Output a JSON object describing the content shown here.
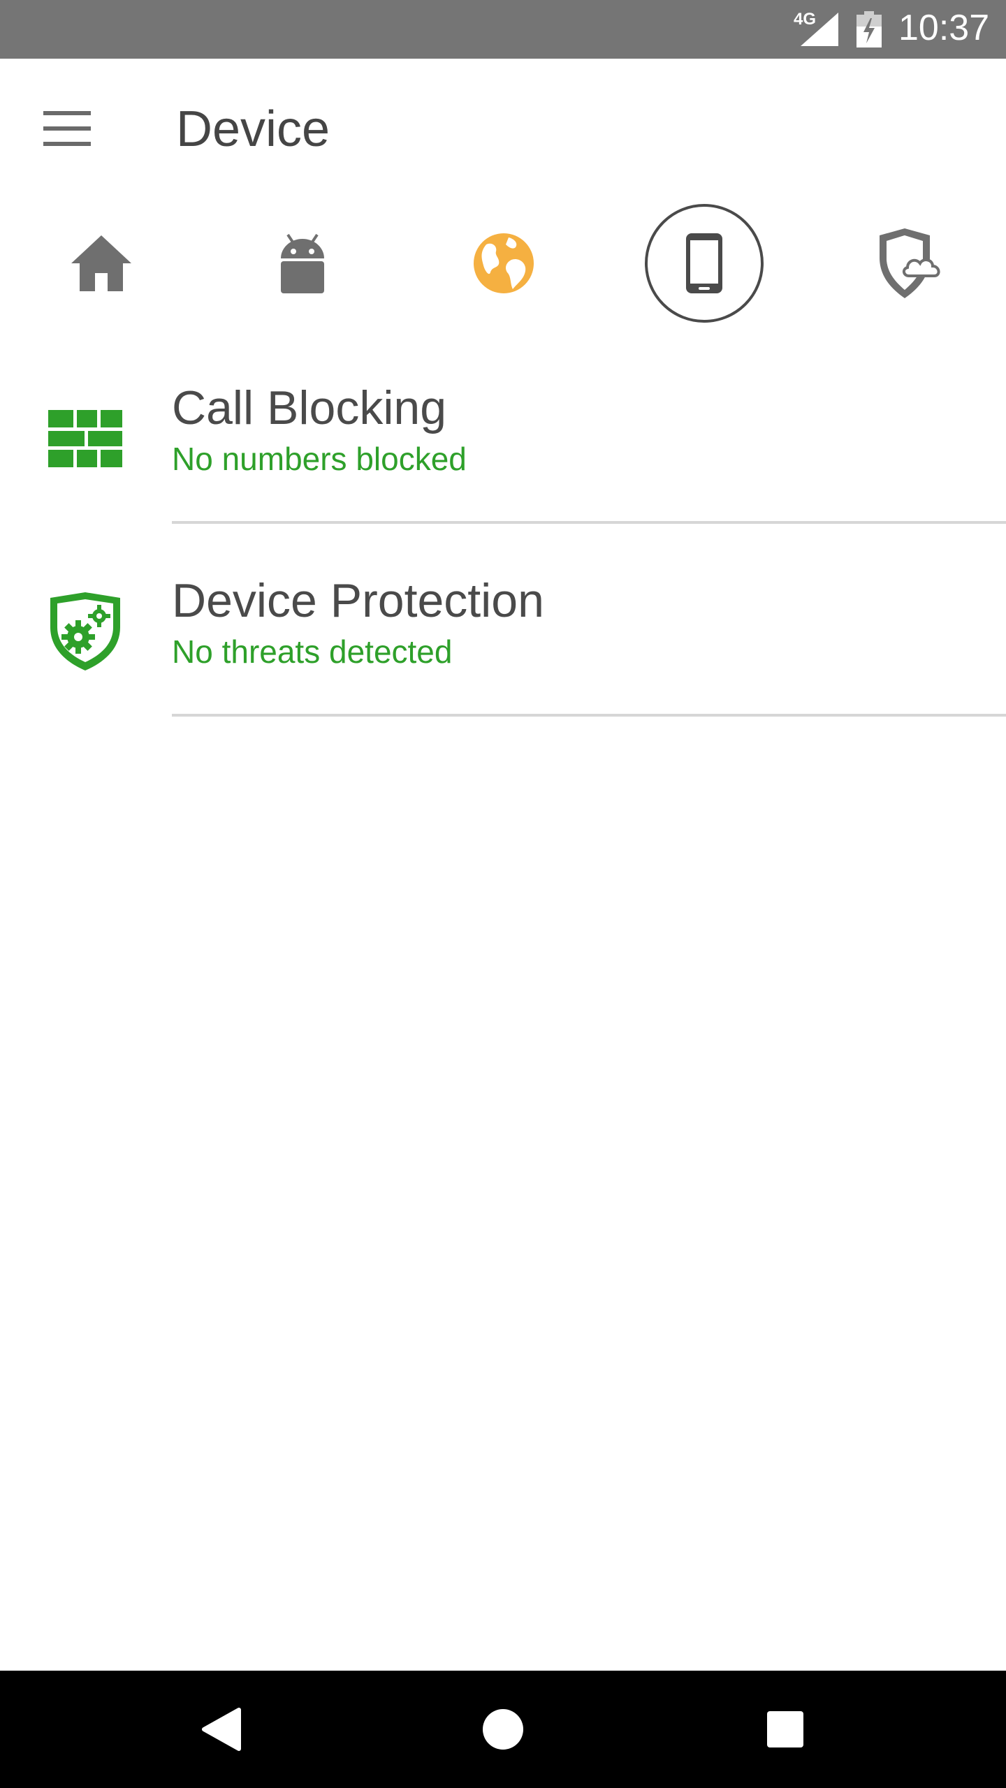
{
  "status_bar": {
    "network": "4G",
    "time": "10:37"
  },
  "app_bar": {
    "menu_icon": "hamburger-menu-icon",
    "title": "Device"
  },
  "tabs": [
    {
      "icon": "home-icon",
      "selected": false,
      "color": "#6f6f6f"
    },
    {
      "icon": "android-icon",
      "selected": false,
      "color": "#6f6f6f"
    },
    {
      "icon": "globe-icon",
      "selected": false,
      "color": "#f5b041"
    },
    {
      "icon": "phone-icon",
      "selected": true,
      "color": "#4a4a4a"
    },
    {
      "icon": "shield-cloud-icon",
      "selected": false,
      "color": "#6f6f6f"
    }
  ],
  "list": {
    "items": [
      {
        "icon": "firewall-brick-icon",
        "title": "Call Blocking",
        "subtitle": "No numbers blocked"
      },
      {
        "icon": "shield-gears-icon",
        "title": "Device Protection",
        "subtitle": "No threats detected"
      }
    ]
  },
  "colors": {
    "accent_green": "#2ea02a",
    "status_bar": "#757575",
    "title_text": "#454545",
    "globe_orange": "#f5b041"
  },
  "nav_bar": {
    "back": "back-triangle-icon",
    "home": "home-circle-icon",
    "recents": "recents-square-icon"
  }
}
